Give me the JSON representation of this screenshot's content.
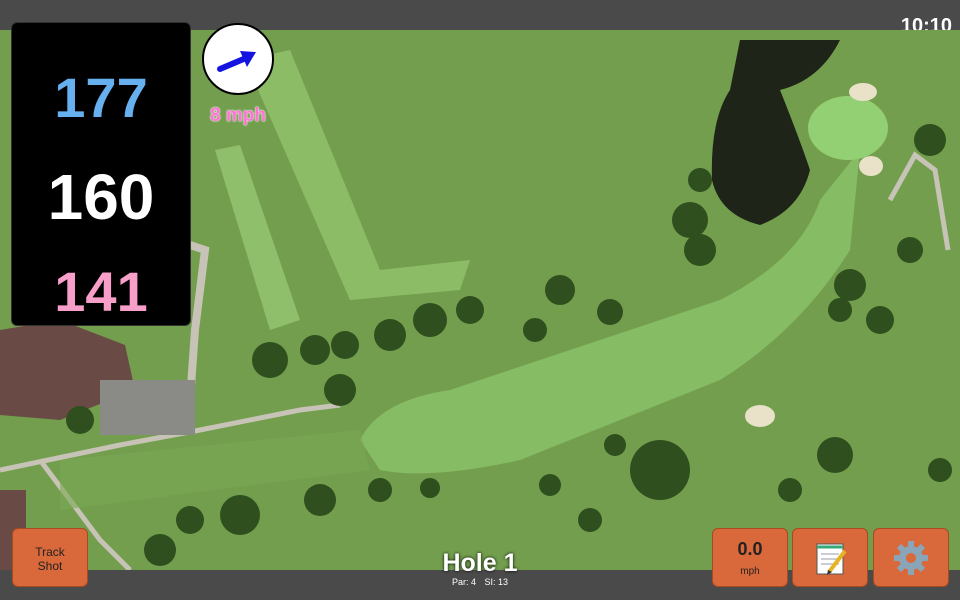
{
  "status": {
    "clock": "10:10"
  },
  "distances": {
    "back": "177",
    "middle": "160",
    "front": "141"
  },
  "wind": {
    "speed_label": "8 mph",
    "icon": "wind-direction-arrow-icon"
  },
  "hole": {
    "title": "Hole 1",
    "par_label": "Par: 4",
    "si_label": "SI: 13"
  },
  "buttons": {
    "track_shot_line1": "Track",
    "track_shot_line2": "Shot",
    "speed_value": "0.0",
    "speed_unit": "mph",
    "notes_icon": "notepad-icon",
    "settings_icon": "gear-icon"
  },
  "colors": {
    "accent_button": "#d9683a",
    "back_distance": "#66b0f0",
    "front_distance": "#f79ec9",
    "wind_label": "#ff73d6"
  }
}
